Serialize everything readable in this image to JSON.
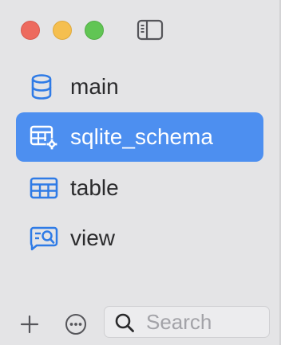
{
  "window": {
    "controls": [
      {
        "name": "close",
        "color": "#ed6a5e"
      },
      {
        "name": "minimize",
        "color": "#f5bf4f"
      },
      {
        "name": "zoom",
        "color": "#61c554"
      }
    ],
    "sidebar_toggle_icon": "sidebar-left-icon"
  },
  "sidebar": {
    "accent_color": "#4d8ff0",
    "icon_color": "#2f7be6",
    "items": [
      {
        "label": "main",
        "icon": "database-icon",
        "selected": false
      },
      {
        "label": "sqlite_schema",
        "icon": "table-gear-icon",
        "selected": true
      },
      {
        "label": "table",
        "icon": "table-icon",
        "selected": false
      },
      {
        "label": "view",
        "icon": "view-icon",
        "selected": false
      }
    ]
  },
  "bottom_bar": {
    "add_icon": "plus-icon",
    "more_icon": "ellipsis-circle-icon",
    "search": {
      "placeholder": "Search",
      "value": "",
      "icon": "magnifier-icon"
    }
  }
}
